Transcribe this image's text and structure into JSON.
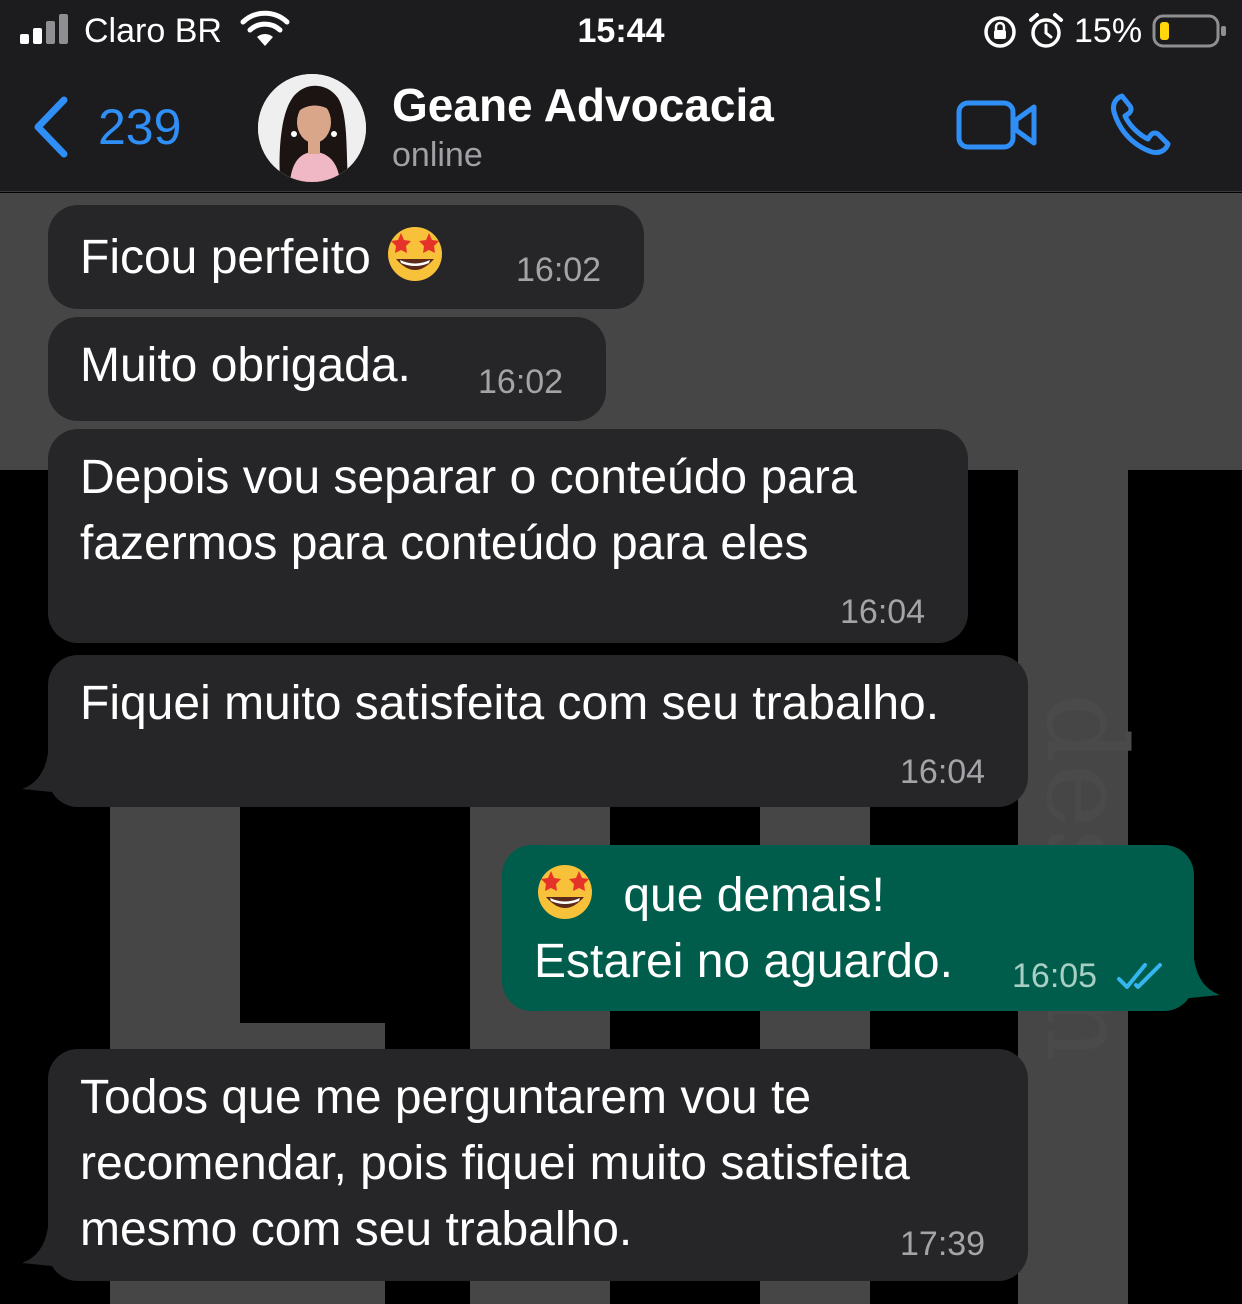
{
  "status_bar": {
    "carrier": "Claro BR",
    "time": "15:44",
    "battery_percent": "15%",
    "icons": [
      "signal-icon",
      "wifi-icon",
      "orientation-lock-icon",
      "alarm-icon",
      "battery-icon"
    ]
  },
  "header": {
    "back_count": "239",
    "contact_name": "Geane Advocacia",
    "contact_status": "online",
    "accent_color": "#2f8ff7"
  },
  "messages": [
    {
      "direction": "in",
      "text": "Ficou perfeito",
      "emoji": "star-struck",
      "time": "16:02"
    },
    {
      "direction": "in",
      "text": "Muito obrigada.",
      "time": "16:02"
    },
    {
      "direction": "in",
      "lines": [
        "Depois vou separar o conteúdo para",
        "fazermos para conteúdo para eles"
      ],
      "time": "16:04"
    },
    {
      "direction": "in",
      "text": "Fiquei muito satisfeita com seu trabalho.",
      "time": "16:04"
    },
    {
      "direction": "out",
      "emoji": "star-struck",
      "lines": [
        "que demais!",
        "Estarei no aguardo."
      ],
      "time": "16:05",
      "status": "read"
    },
    {
      "direction": "in",
      "lines": [
        "Todos que me perguntarem vou te",
        "recomendar, pois fiquei muito satisfeita",
        "mesmo com seu trabalho."
      ],
      "time": "17:39"
    }
  ],
  "colors": {
    "incoming_bubble": "#262628",
    "outgoing_bubble": "#005c4b",
    "read_ticks": "#34b7f1"
  }
}
